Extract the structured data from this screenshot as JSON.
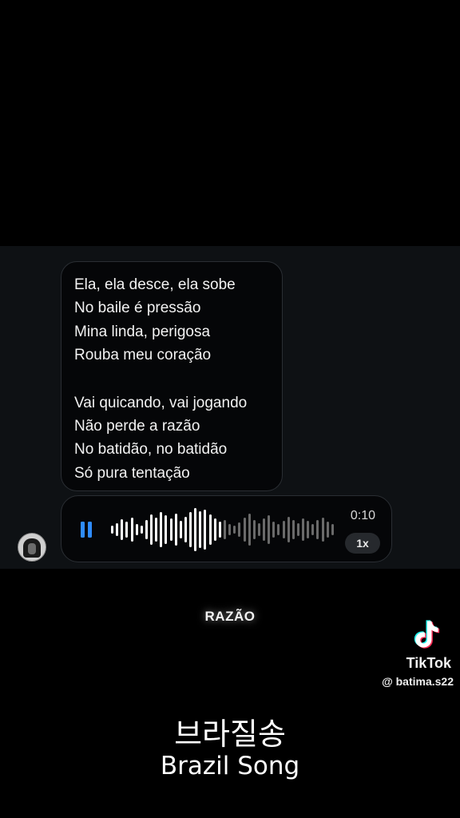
{
  "chat": {
    "lyrics_stanza_1": [
      "Ela, ela desce, ela sobe",
      "No baile é pressão",
      "Mina linda, perigosa",
      "Rouba meu coração"
    ],
    "lyrics_stanza_2": [
      "Vai quicando, vai jogando",
      "Não perde a razão",
      "No batidão, no batidão",
      "Só pura tentação"
    ],
    "voice_message": {
      "icon": "pause-icon",
      "duration": "0:10",
      "speed": "1x",
      "played_fraction": 0.5,
      "colors": {
        "played": "#ffffff",
        "unplayed": "#6a6a6a",
        "pause": "#2f8cff"
      }
    }
  },
  "overlay": {
    "caption_word": "RAZÃO",
    "tiktok_brand": "TikTok",
    "tiktok_handle": "@ batima.s22",
    "title_korean": "브라질송",
    "title_english": "Brazil Song"
  }
}
